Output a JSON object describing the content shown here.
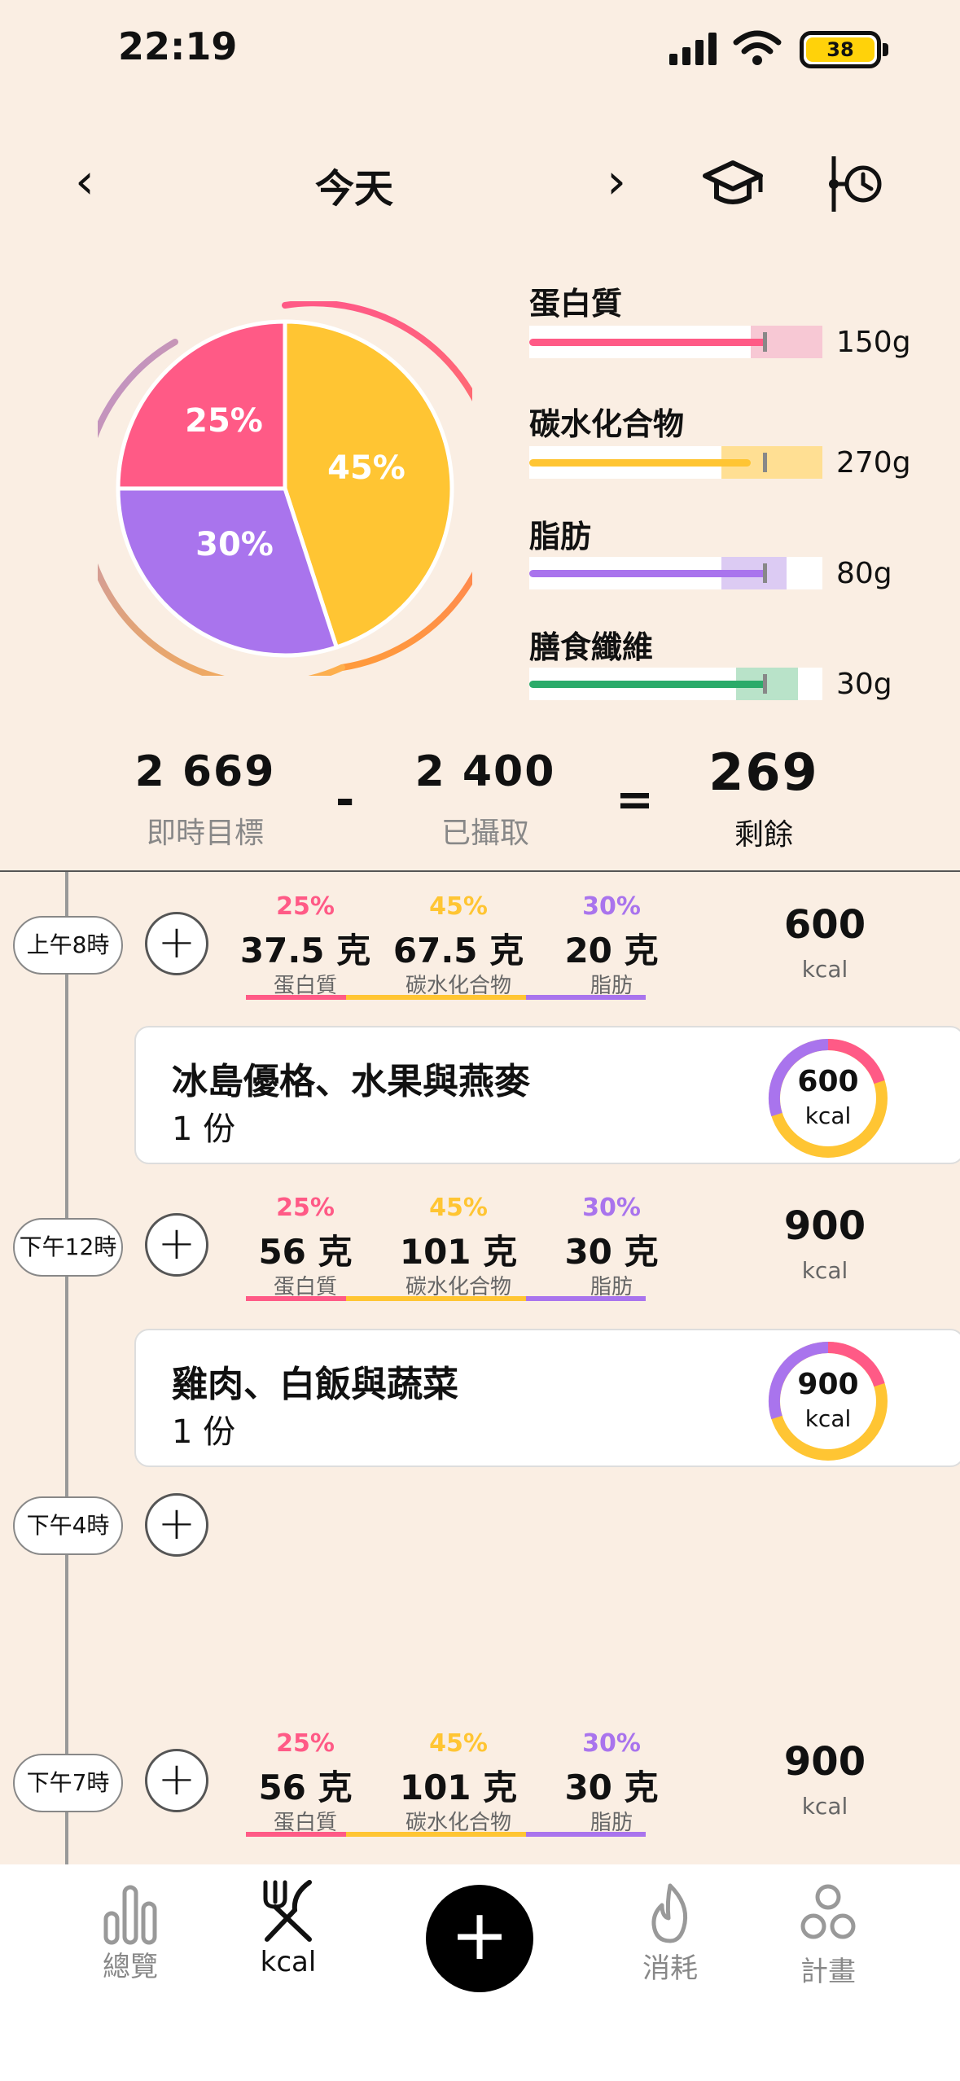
{
  "status_bar": {
    "time": "22:19",
    "battery": "38"
  },
  "header": {
    "title": "今天",
    "prev": "‹",
    "next": "›",
    "learn_icon": "graduation-cap-icon",
    "history_icon": "timeline-clock-icon"
  },
  "colors": {
    "protein": "#ff5a86",
    "carbs": "#ffc533",
    "fat": "#a974ed",
    "fiber": "#2bab6a"
  },
  "chart_data": {
    "type": "pie",
    "slices": [
      {
        "label": "25%",
        "value": 25,
        "macro": "protein"
      },
      {
        "label": "45%",
        "value": 45,
        "macro": "carbs"
      },
      {
        "label": "30%",
        "value": 30,
        "macro": "fat"
      }
    ]
  },
  "macros": [
    {
      "name": "蛋白質",
      "target": "150g"
    },
    {
      "name": "碳水化合物",
      "target": "270g"
    },
    {
      "name": "脂肪",
      "target": "80g"
    },
    {
      "name": "膳食纖維",
      "target": "30g"
    }
  ],
  "summary": {
    "goal_value": "2 669",
    "goal_label": "即時目標",
    "minus": "-",
    "eaten_value": "2 400",
    "eaten_label": "已攝取",
    "equals": "=",
    "remaining_value": "269",
    "remaining_label": "剩餘"
  },
  "slots": [
    {
      "time": "上午8時",
      "add": "+",
      "protein_pct": "25%",
      "protein_g": "37.5 克",
      "protein_lbl": "蛋白質",
      "carbs_pct": "45%",
      "carbs_g": "67.5 克",
      "carbs_lbl": "碳水化合物",
      "fat_pct": "30%",
      "fat_g": "20 克",
      "fat_lbl": "脂肪",
      "kcal": "600",
      "kcal_unit": "kcal"
    },
    {
      "time": "下午12時",
      "add": "+",
      "protein_pct": "25%",
      "protein_g": "56 克",
      "protein_lbl": "蛋白質",
      "carbs_pct": "45%",
      "carbs_g": "101 克",
      "carbs_lbl": "碳水化合物",
      "fat_pct": "30%",
      "fat_g": "30 克",
      "fat_lbl": "脂肪",
      "kcal": "900",
      "kcal_unit": "kcal"
    },
    {
      "time": "下午4時",
      "add": "+"
    },
    {
      "time": "下午7時",
      "add": "+",
      "protein_pct": "25%",
      "protein_g": "56 克",
      "protein_lbl": "蛋白質",
      "carbs_pct": "45%",
      "carbs_g": "101 克",
      "carbs_lbl": "碳水化合物",
      "fat_pct": "30%",
      "fat_g": "30 克",
      "fat_lbl": "脂肪",
      "kcal": "900",
      "kcal_unit": "kcal"
    }
  ],
  "meals": [
    {
      "name": "冰島優格、水果與燕麥",
      "qty": "1 份",
      "kcal": "600",
      "unit": "kcal"
    },
    {
      "name": "雞肉、白飯與蔬菜",
      "qty": "1 份",
      "kcal": "900",
      "unit": "kcal"
    }
  ],
  "tabbar": {
    "overview": "總覽",
    "kcal": "kcal",
    "add": "+",
    "burn": "消耗",
    "plan": "計畫"
  }
}
